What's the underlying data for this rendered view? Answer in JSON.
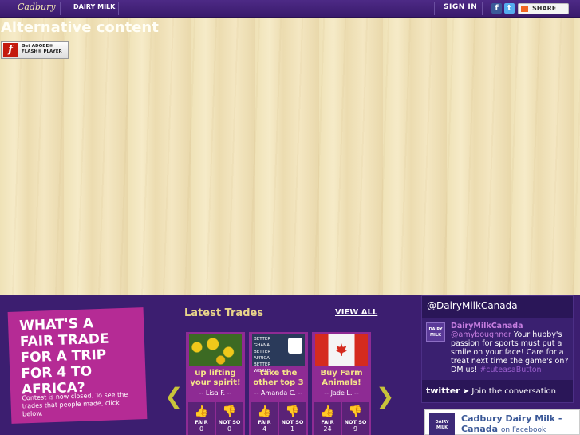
{
  "header": {
    "cadbury_logo": "Cadbury",
    "dairymilk_logo": "DAIRY MILK",
    "signin_label": "SIGN IN",
    "facebook_icon": "f",
    "twitter_icon": "t",
    "share_label": "SHARE"
  },
  "flash": {
    "alt_text": "Alternative content",
    "badge_line1": "Get ADOBE®",
    "badge_line2": "FLASH® PLAYER"
  },
  "contest": {
    "headline": "WHAT'S A FAIR TRADE FOR A TRIP FOR 4 TO AFRICA?",
    "note": "Contest is now closed. To see the trades that people made, click below."
  },
  "latest": {
    "title": "Latest Trades",
    "view_all": "VIEW ALL",
    "prev_arrow": "❮",
    "next_arrow": "❯",
    "trades": [
      {
        "title": "up lifting your spirit!",
        "by": "-- Lisa F. --",
        "fair_label": "FAIR",
        "fair": "0",
        "notso_label": "NOT SO",
        "notso": "0"
      },
      {
        "title": "take the other top 3",
        "by": "-- Amanda C. --",
        "fair_label": "FAIR",
        "fair": "4",
        "notso_label": "NOT SO",
        "notso": "1",
        "image_text": "BETTER GHANA BETTER AFRICA BETTER WORLD"
      },
      {
        "title": "Buy Farm Animals!",
        "by": "-- Jade L. --",
        "fair_label": "FAIR",
        "fair": "24",
        "notso_label": "NOT SO",
        "notso": "9"
      }
    ]
  },
  "twitter": {
    "handle": "@DairyMilkCanada",
    "avatar_text": "DAIRY MILK",
    "tweet_user": "DairyMilkCanada",
    "tweet_mention": "@amyboughner",
    "tweet_body": " Your hubby's passion for sports must put a smile on your face! Care for a treat next time the game's on? DM us!",
    "tweet_tag": "#cuteasaButton",
    "logo": "twitter",
    "join": "Join the conversation"
  },
  "facebook": {
    "avatar_text": "DAIRY MILK",
    "page_name": "Cadbury Dairy Milk - Canada",
    "on_label": "on Facebook"
  },
  "colors": {
    "brand_purple": "#3c1e70",
    "accent_magenta": "#b52b95",
    "title_gold": "#e8d48a"
  }
}
